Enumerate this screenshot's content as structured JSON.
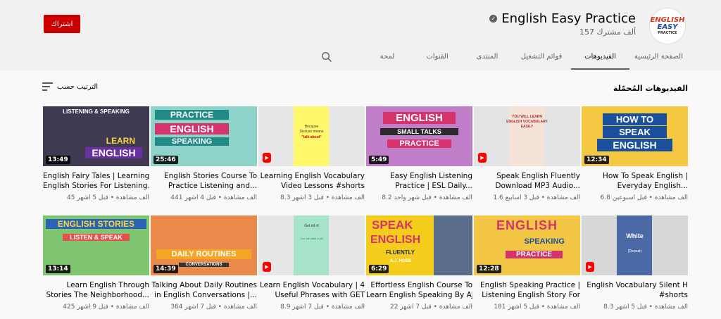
{
  "channel": {
    "name": "English Easy Practice",
    "subscribers": "157 ألف مشترك",
    "subscribe_label": "اشتراك",
    "avatar_line1": "ENGLISH",
    "avatar_line2": "EASY",
    "avatar_line3": "PRACTICE"
  },
  "tabs": [
    {
      "label": "الصفحة الرئيسية",
      "active": false
    },
    {
      "label": "الفيديوهات",
      "active": true
    },
    {
      "label": "قوائم التشغيل",
      "active": false
    },
    {
      "label": "المنتدى",
      "active": false
    },
    {
      "label": "القنوات",
      "active": false
    },
    {
      "label": "لمحة",
      "active": false
    }
  ],
  "section": {
    "title": "الفيديوهات المُحمّلة",
    "sort_label": "الترتيب حسب"
  },
  "videos": [
    {
      "title1": "How To Speak English |",
      "title2": "Everyday English...",
      "meta": "6.8 ألف مشاهدة • قبل أسبوعين",
      "duration": "12:34",
      "thumb_text": "HOW TO SPEAK ENGLISH",
      "thumb_bg": "#f5c842"
    },
    {
      "title1": "Speak English Fluently",
      "title2": "Download MP3 Audio...",
      "meta": "1.6 ألف مشاهدة • قبل 3 أسابيع",
      "duration": "",
      "thumb_text": "YOU WILL LEARN ENGLISH VOCABULARY EASILY",
      "thumb_bg": "#f6e3d7"
    },
    {
      "title1": "Easy English Listening",
      "title2": "Practice | ESL Daily...",
      "meta": "8.2 ألف مشاهدة • قبل شهر واحد",
      "duration": "5:49",
      "thumb_text": "ENGLISH SMALL TALKS PRACTICE",
      "thumb_bg": "#c07ec8"
    },
    {
      "title1": "Learning English Vocabulary",
      "title2": "Video Lessons #shorts",
      "meta": "8.3 ألف مشاهدة • قبل 3 أشهر",
      "duration": "",
      "thumb_text": "Because Discuss means \"talk about\"",
      "thumb_bg": "#fff86a"
    },
    {
      "title1": "English Stories Course To",
      "title2": "Practice Listening and...",
      "meta": "441 ألف مشاهدة • قبل 4 أشهر",
      "duration": "25:46",
      "thumb_text": "PRACTICE ENGLISH SPEAKING",
      "thumb_bg": "#8ed3c9"
    },
    {
      "title1": "English Fairy Tales | Learning",
      "title2": "English Stories For Listening...",
      "meta": "45 ألف مشاهدة • قبل 5 أشهر",
      "duration": "13:49",
      "thumb_text": "LEARN ENGLISH",
      "thumb_bg": "#3f3a52"
    },
    {
      "title1": "English Vocabulary Silent H",
      "title2": "#shorts",
      "meta": "8.3 ألف مشاهدة • قبل 5 أشهر",
      "duration": "",
      "thumb_text": "White",
      "thumb_bg": "#d8d8d8"
    },
    {
      "title1": "English Speaking Practice |",
      "title2": "Listening English Story For",
      "meta": "181 ألف مشاهدة • قبل 5 أشهر",
      "duration": "12:28",
      "thumb_text": "ENGLISH SPEAKING PRACTICE",
      "thumb_bg": "#f3c645"
    },
    {
      "title1": "Effortless English Course To",
      "title2": "Learn English Speaking By AJ...",
      "meta": "22 ألف مشاهدة • قبل 7 أشهر",
      "duration": "6:29",
      "thumb_text": "SPEAK ENGLISH FLUENTLY",
      "thumb_bg": "#f4cd1c"
    },
    {
      "title1": "Learn English Vocabulary | 4",
      "title2": "Useful Phrases with GET",
      "meta": "8.9 ألف مشاهدة • قبل 7 أشهر",
      "duration": "",
      "thumb_text": "Get rid of",
      "thumb_bg": "#a7e3c8"
    },
    {
      "title1": "Talking About Daily Routines",
      "title2": "in English Conversations |...",
      "meta": "364 ألف مشاهدة • قبل 7 أشهر",
      "duration": "14:39",
      "thumb_text": "DAILY ROUTINES CONVERSATIONS",
      "thumb_bg": "#e98a4a"
    },
    {
      "title1": "Learn English Through",
      "title2": "Stories The Neighborhood...",
      "meta": "425 ألف مشاهدة • قبل 9 أشهر",
      "duration": "13:14",
      "thumb_text": "ENGLISH STORIES LISTEN & SPEAK",
      "thumb_bg": "#7fc46e"
    }
  ]
}
